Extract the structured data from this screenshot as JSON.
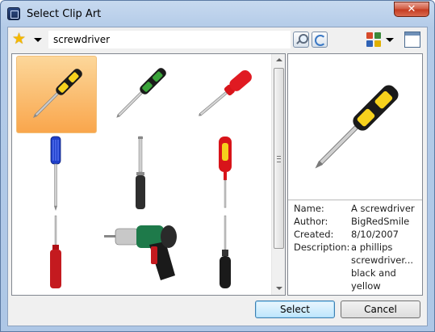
{
  "window": {
    "title": "Select Clip Art",
    "close_label": "✕",
    "app_icon": "clip-art-app-icon"
  },
  "toolbar": {
    "favorites_icon": "star-icon",
    "search_value": "screwdriver",
    "search_icon": "magnifier-icon",
    "refresh_icon": "refresh-icon",
    "view_icon": "view-mode-icon",
    "preview_toggle_icon": "preview-pane-icon"
  },
  "gallery": {
    "items": [
      {
        "name": "yellow-black-screwdriver",
        "selected": true
      },
      {
        "name": "green-black-screwdriver",
        "selected": false
      },
      {
        "name": "red-handle-screwdriver",
        "selected": false
      },
      {
        "name": "blue-screwdriver",
        "selected": false
      },
      {
        "name": "black-flat-screwdriver",
        "selected": false
      },
      {
        "name": "red-yellow-screwdriver",
        "selected": false
      },
      {
        "name": "red-handle-screwdriver-2",
        "selected": false
      },
      {
        "name": "cordless-electric-screwdriver",
        "selected": false
      },
      {
        "name": "black-screwdriver",
        "selected": false
      }
    ]
  },
  "details": {
    "name_label": "Name:",
    "name_value": "A screwdriver",
    "author_label": "Author:",
    "author_value": "BigRedSmile",
    "created_label": "Created:",
    "created_value": "8/10/2007",
    "description_label": "Description:",
    "description_line1": "a phillips",
    "description_line2": "screwdriver...",
    "description_line3": "black and",
    "description_line4": "yellow"
  },
  "buttons": {
    "select_label": "Select",
    "cancel_label": "Cancel"
  },
  "colors": {
    "selection": "#f9a64c",
    "accent_yellow": "#f6d11c",
    "frame": "#b3cbe8"
  }
}
